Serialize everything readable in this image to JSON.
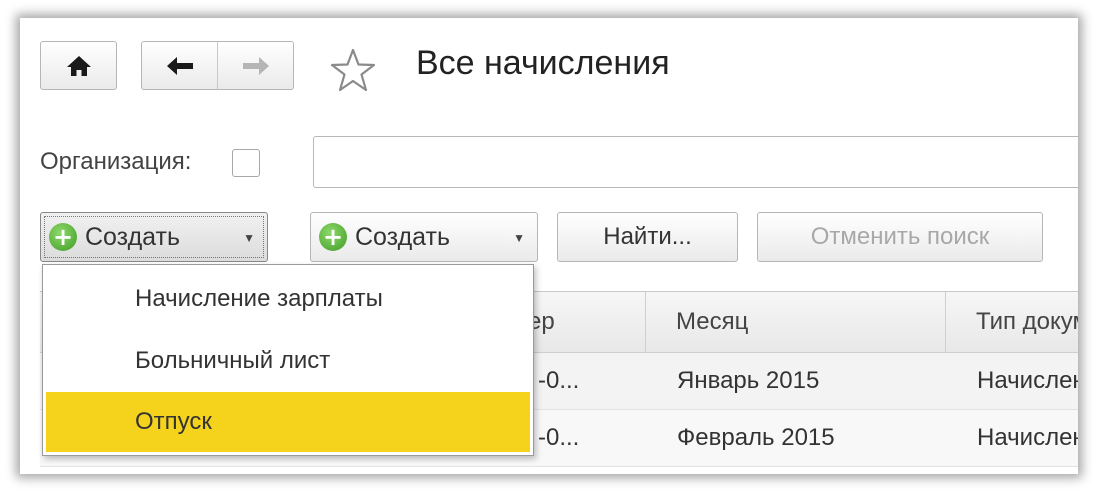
{
  "header": {
    "title": "Все начисления",
    "icons": {
      "home": "home-icon",
      "back": "arrow-left-icon",
      "forward": "arrow-right-icon",
      "favorite": "star-icon"
    }
  },
  "filter": {
    "organization_label": "Организация:",
    "organization_value": ""
  },
  "toolbar": {
    "create_label_1": "Создать",
    "create_label_2": "Создать",
    "find_label": "Найти...",
    "cancel_search_label": "Отменить поиск"
  },
  "create_menu": {
    "items": [
      {
        "label": "Начисление зарплаты"
      },
      {
        "label": "Больничный лист"
      },
      {
        "label": "Отпуск"
      }
    ],
    "highlight_color": "#f5d31c"
  },
  "table": {
    "columns": [
      "ер",
      "Месяц",
      "Тип докум"
    ],
    "rows": [
      {
        "num": "-0...",
        "month": "Январь 2015",
        "type": "Начислен"
      },
      {
        "num": "-0...",
        "month": "Февраль 2015",
        "type": "Начислен"
      }
    ]
  }
}
